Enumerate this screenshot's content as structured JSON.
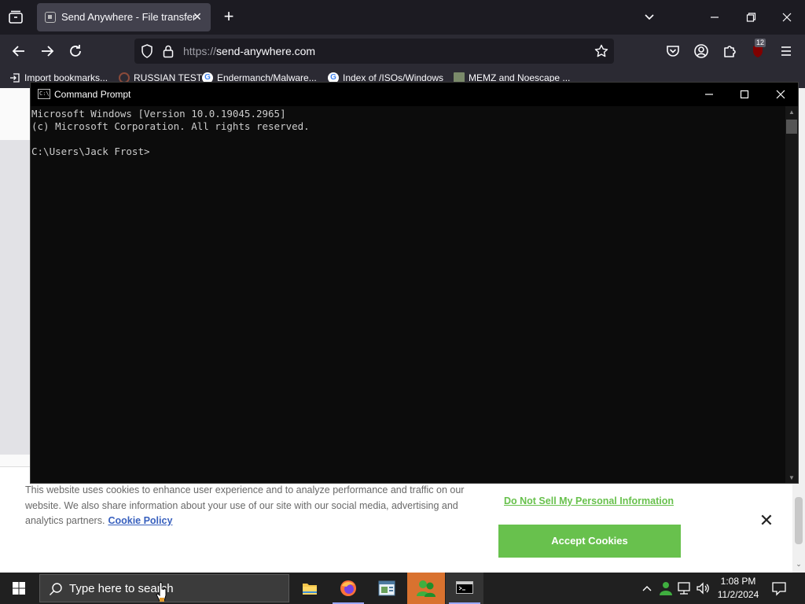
{
  "browser": {
    "tab": {
      "title": "Send Anywhere - File transfer"
    },
    "url": {
      "protocol": "https://",
      "host": "send-anywhere.com"
    },
    "extension_badge": "12",
    "bookmarks": [
      {
        "label": "Import bookmarks..."
      },
      {
        "label": "RUSSIAN TEST"
      },
      {
        "label": "Endermanch/Malware..."
      },
      {
        "label": "Index of /ISOs/Windows"
      },
      {
        "label": "MEMZ and Noescape ..."
      }
    ]
  },
  "cmd": {
    "title": "Command Prompt",
    "lines": [
      "Microsoft Windows [Version 10.0.19045.2965]",
      "(c) Microsoft Corporation. All rights reserved.",
      "",
      "C:\\Users\\Jack Frost>"
    ]
  },
  "cookie_banner": {
    "text": "This website uses cookies to enhance user experience and to analyze performance and traffic on our website. We also share information about your use of our site with our social media, advertising and analytics partners.",
    "policy_link": "Cookie Policy",
    "do_not_sell": "Do Not Sell My Personal Information",
    "accept": "Accept Cookies"
  },
  "taskbar": {
    "search_placeholder": "Type here to search",
    "time": "1:08 PM",
    "date": "11/2/2024"
  },
  "colors": {
    "accept_green": "#68c14d",
    "link_blue": "#3860be",
    "browser_dark": "#1c1b22"
  }
}
